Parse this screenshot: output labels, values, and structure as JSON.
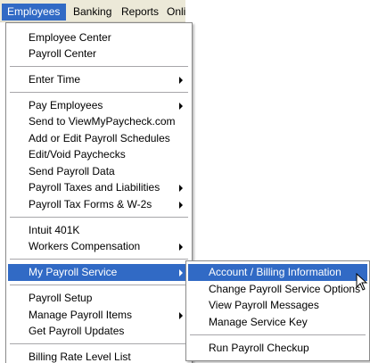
{
  "menubar": {
    "items": [
      {
        "label": "Employees"
      },
      {
        "label": "Banking"
      },
      {
        "label": "Reports"
      },
      {
        "label": "Onlin"
      }
    ]
  },
  "employees_menu": {
    "items": [
      {
        "label": "Employee Center"
      },
      {
        "label": "Payroll Center"
      },
      {
        "label": "Enter Time"
      },
      {
        "label": "Pay Employees"
      },
      {
        "label": "Send to ViewMyPaycheck.com"
      },
      {
        "label": "Add or Edit Payroll Schedules"
      },
      {
        "label": "Edit/Void Paychecks"
      },
      {
        "label": "Send Payroll Data"
      },
      {
        "label": "Payroll Taxes and Liabilities"
      },
      {
        "label": "Payroll Tax Forms & W-2s"
      },
      {
        "label": "Intuit 401K"
      },
      {
        "label": "Workers Compensation"
      },
      {
        "label": "My Payroll Service"
      },
      {
        "label": "Payroll Setup"
      },
      {
        "label": "Manage Payroll Items"
      },
      {
        "label": "Get Payroll Updates"
      },
      {
        "label": "Billing Rate Level List"
      }
    ]
  },
  "payroll_service_submenu": {
    "items": [
      {
        "label": "Account / Billing Information"
      },
      {
        "label": "Change Payroll Service Options"
      },
      {
        "label": "View Payroll Messages"
      },
      {
        "label": "Manage Service Key"
      },
      {
        "label": "Run Payroll Checkup"
      }
    ]
  },
  "colors": {
    "highlight": "#316ac5",
    "menubar_bg": "#ece9d8"
  },
  "icons": {
    "submenu_arrow": "chevron-right-icon",
    "cursor": "mouse-pointer-icon"
  }
}
